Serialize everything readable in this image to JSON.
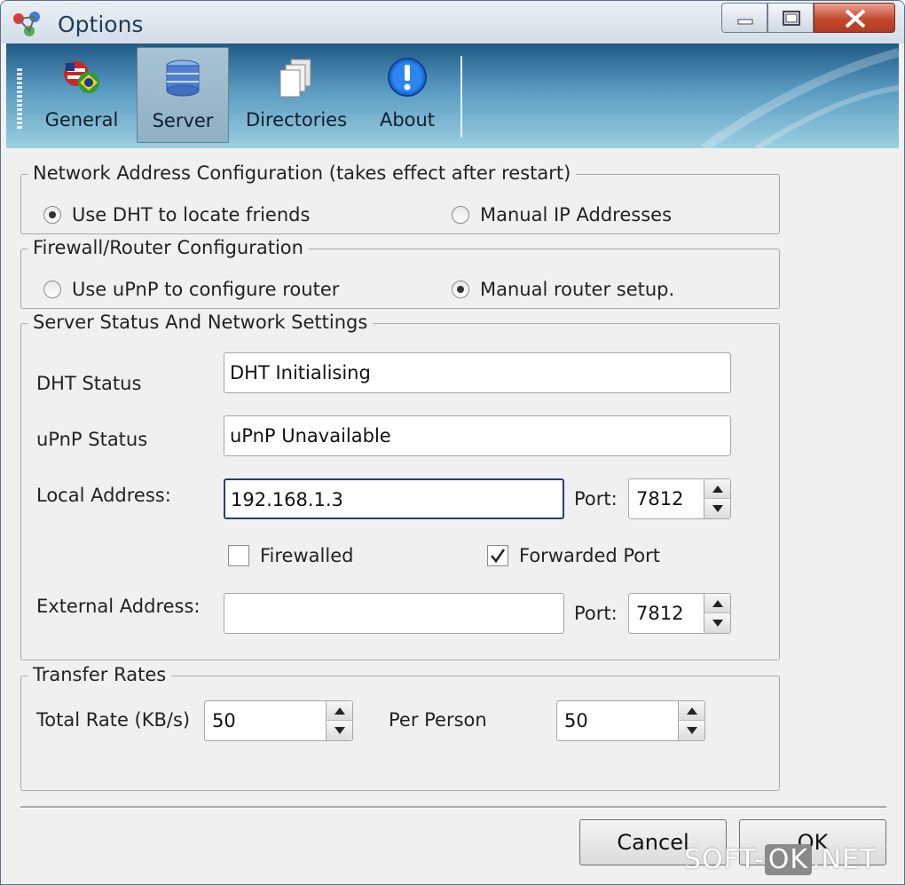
{
  "window": {
    "title": "Options"
  },
  "tabs": [
    {
      "label": "General",
      "icon": "flags-icon"
    },
    {
      "label": "Server",
      "icon": "server-icon",
      "active": true
    },
    {
      "label": "Directories",
      "icon": "directories-icon"
    },
    {
      "label": "About",
      "icon": "about-info-icon"
    }
  ],
  "network": {
    "legend": "Network Address Configuration (takes effect after restart)",
    "option_dht": "Use DHT to locate friends",
    "option_manual": "Manual IP Addresses",
    "selected": "dht"
  },
  "firewall": {
    "legend": "Firewall/Router Configuration",
    "option_upnp": "Use uPnP to configure router",
    "option_manual": "Manual router setup.",
    "selected": "manual"
  },
  "status": {
    "legend": "Server Status And Network Settings",
    "dht_label": "DHT Status",
    "dht_value": "DHT Initialising",
    "upnp_label": "uPnP Status",
    "upnp_value": "uPnP Unavailable",
    "local_label": "Local Address:",
    "local_value": "192.168.1.3",
    "port_label": "Port:",
    "local_port": "7812",
    "firewalled_label": "Firewalled",
    "firewalled_checked": false,
    "forwarded_label": "Forwarded Port",
    "forwarded_checked": true,
    "external_label": "External Address:",
    "external_value": "",
    "external_port": "7812"
  },
  "rates": {
    "legend": "Transfer Rates",
    "total_label": "Total Rate (KB/s)",
    "total_value": "50",
    "per_label": "Per Person",
    "per_value": "50"
  },
  "buttons": {
    "cancel": "Cancel",
    "ok": "OK"
  },
  "watermark": {
    "left": "SOFT-",
    "mid": "OK",
    "right": ".NET"
  }
}
